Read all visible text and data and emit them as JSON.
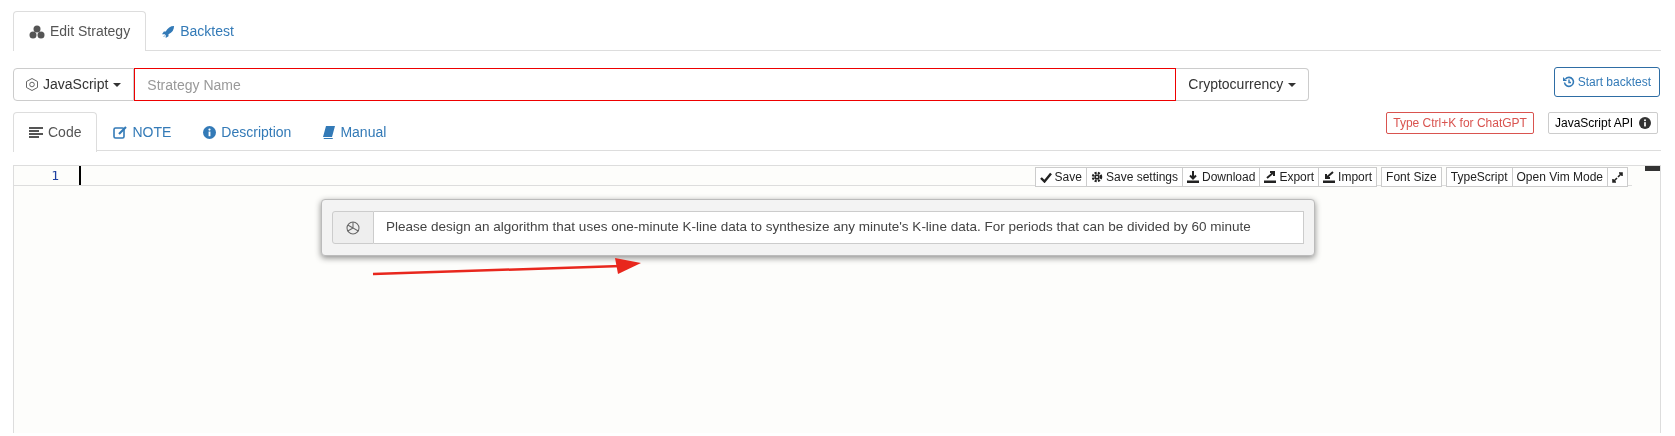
{
  "top_tabs": [
    {
      "label": "Edit Strategy",
      "selected": true
    },
    {
      "label": "Backtest",
      "selected": false
    }
  ],
  "language_dropdown": {
    "label": "JavaScript"
  },
  "strategy_name": {
    "placeholder": "Strategy Name"
  },
  "category_dropdown": {
    "label": "Cryptocurrency"
  },
  "start_backtest_button": {
    "label": "Start backtest"
  },
  "code_tabs": [
    {
      "label": "Code",
      "selected": true
    },
    {
      "label": "NOTE",
      "selected": false
    },
    {
      "label": "Description",
      "selected": false
    },
    {
      "label": "Manual",
      "selected": false
    }
  ],
  "chatgpt_hint": "Type Ctrl+K for ChatGPT",
  "api_button": {
    "label": "JavaScript API"
  },
  "editor": {
    "line_numbers": [
      "1"
    ],
    "toolbar": [
      "Save",
      "Save settings",
      "Download",
      "Export",
      "Import",
      "Font Size",
      "TypeScript",
      "Open Vim Mode"
    ]
  },
  "chatgpt_prompt": {
    "value": "Please design an algorithm that uses one-minute K-line data to synthesize any minute's K-line data. For periods that can be divided by 60 minute"
  }
}
